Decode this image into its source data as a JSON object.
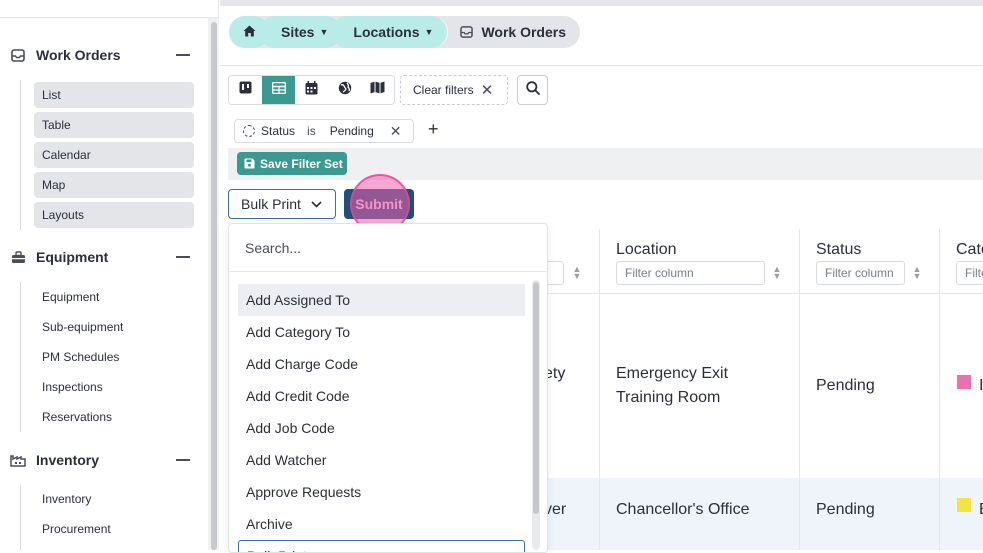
{
  "sidebar": {
    "sections": [
      {
        "label": "Work Orders",
        "icon": "inbox-icon",
        "items": [
          "List",
          "Table",
          "Calendar",
          "Map",
          "Layouts"
        ]
      },
      {
        "label": "Equipment",
        "icon": "toolbox-icon",
        "items": [
          "Equipment",
          "Sub-equipment",
          "PM Schedules",
          "Inspections",
          "Reservations"
        ]
      },
      {
        "label": "Inventory",
        "icon": "warehouse-icon",
        "items": [
          "Inventory",
          "Procurement"
        ]
      }
    ]
  },
  "breadcrumb": {
    "home_icon": "home-icon",
    "items": [
      "Sites",
      "Locations"
    ],
    "current": "Work Orders",
    "current_icon": "inbox-icon"
  },
  "toolbar": {
    "views": [
      "kanban-icon",
      "table-icon",
      "calendar-icon",
      "globe-icon",
      "map-icon"
    ],
    "active_view": "table-icon",
    "clear_filters": "Clear filters",
    "search_icon": "search-icon"
  },
  "filter": {
    "field": "Status",
    "operator": "is",
    "value": "Pending",
    "save_label": "Save Filter Set"
  },
  "bulk": {
    "select_value": "Bulk Print",
    "submit_label": "Submit"
  },
  "dropdown": {
    "search_placeholder": "Search...",
    "options": [
      "Add Assigned To",
      "Add Category To",
      "Add Charge Code",
      "Add Credit Code",
      "Add Job Code",
      "Add Watcher",
      "Approve Requests",
      "Archive",
      "Bulk Print"
    ],
    "highlighted": "Add Assigned To"
  },
  "table": {
    "columns": [
      "Location",
      "Status",
      "Cate"
    ],
    "filter_placeholder": "Filter column",
    "filter_placeholder_cut": "Filte",
    "rows": [
      {
        "partial": "ety",
        "location_line1": "Emergency Exit",
        "location_line2": "Training Room",
        "status": "Pending",
        "category_color": "#ec6fae",
        "category_partial": "I"
      },
      {
        "partial": "ver",
        "location_line1": "Chancellor's Office",
        "location_line2": "",
        "status": "Pending",
        "category_color": "#f2e63a",
        "category_partial": "E"
      }
    ]
  }
}
